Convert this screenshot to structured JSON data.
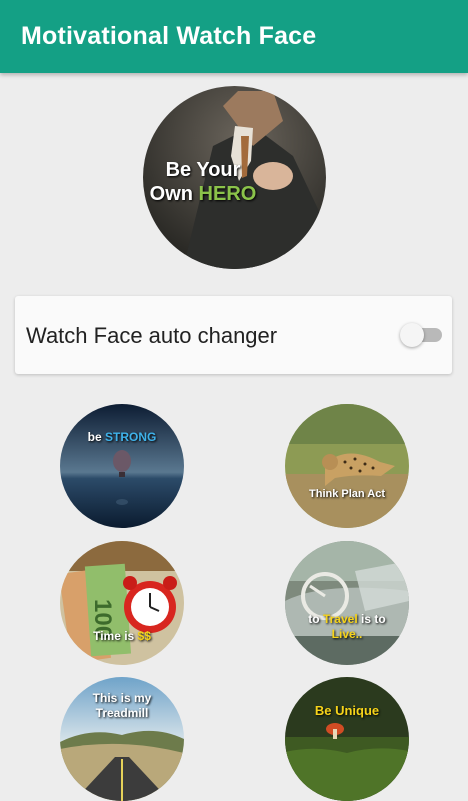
{
  "appbar": {
    "title": "Motivational Watch Face"
  },
  "hero": {
    "line1": "Be Your",
    "line2_part1": "Own ",
    "line2_part2": "HERO"
  },
  "auto_changer": {
    "label": "Watch Face auto changer",
    "enabled": false
  },
  "faces": [
    {
      "part1": "be ",
      "part2": "STRONG"
    },
    {
      "text": "Think   Plan   Act"
    },
    {
      "part1": "Time is ",
      "part2": "$$"
    },
    {
      "part1": "to ",
      "part2": "Travel",
      "part3": " is to",
      "part4": "Live.."
    },
    {
      "line1": "This is my",
      "line2": "Treadmill"
    },
    {
      "text": "Be Unique"
    }
  ],
  "colors": {
    "appbar": "#14a085",
    "accent_green": "#8bc34a",
    "switch_off_track": "#b9b9b9"
  }
}
